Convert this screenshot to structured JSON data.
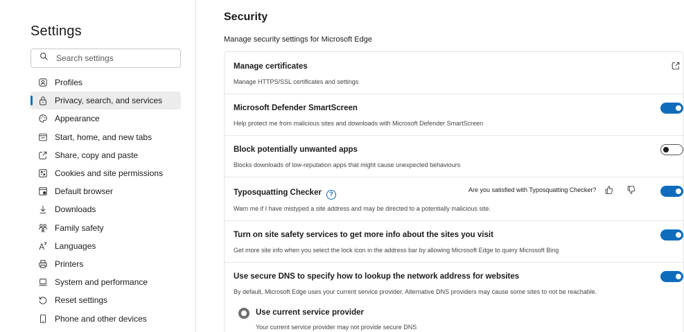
{
  "sidebar": {
    "title": "Settings",
    "search_placeholder": "Search settings",
    "items": [
      {
        "label": "Profiles",
        "icon": "profile-icon",
        "active": false
      },
      {
        "label": "Privacy, search, and services",
        "icon": "lock-icon",
        "active": true
      },
      {
        "label": "Appearance",
        "icon": "appearance-icon",
        "active": false
      },
      {
        "label": "Start, home, and new tabs",
        "icon": "home-tabs-icon",
        "active": false
      },
      {
        "label": "Share, copy and paste",
        "icon": "share-icon",
        "active": false
      },
      {
        "label": "Cookies and site permissions",
        "icon": "cookies-icon",
        "active": false
      },
      {
        "label": "Default browser",
        "icon": "browser-icon",
        "active": false
      },
      {
        "label": "Downloads",
        "icon": "download-icon",
        "active": false
      },
      {
        "label": "Family safety",
        "icon": "family-icon",
        "active": false
      },
      {
        "label": "Languages",
        "icon": "languages-icon",
        "active": false
      },
      {
        "label": "Printers",
        "icon": "printer-icon",
        "active": false
      },
      {
        "label": "System and performance",
        "icon": "system-icon",
        "active": false
      },
      {
        "label": "Reset settings",
        "icon": "reset-icon",
        "active": false
      },
      {
        "label": "Phone and other devices",
        "icon": "phone-icon",
        "active": false
      }
    ]
  },
  "main": {
    "title": "Security",
    "subtitle": "Manage security settings for Microsoft Edge",
    "rows": {
      "certificates": {
        "title": "Manage certificates",
        "desc": "Manage HTTPS/SSL certificates and settings"
      },
      "smartscreen": {
        "title": "Microsoft Defender SmartScreen",
        "desc": "Help protect me from malicious sites and downloads with Microsoft Defender SmartScreen",
        "enabled": true
      },
      "pua": {
        "title": "Block potentially unwanted apps",
        "desc": "Blocks downloads of low-reputation apps that might cause unexpected behaviours",
        "enabled": false
      },
      "typosquatting": {
        "title": "Typosquatting Checker",
        "help": "?",
        "feedback": "Are you satisfied with Typosquatting Checker?",
        "desc": "Warn me if I have mistyped a site address and may be directed to a potentially malicious site.",
        "enabled": true
      },
      "site_safety": {
        "title": "Turn on site safety services to get more info about the sites you visit",
        "desc": "Get more site info when you select the lock icon in the address bar by allowing Microsoft Edge to query Microsoft Bing",
        "enabled": true
      },
      "secure_dns": {
        "title": "Use secure DNS to specify how to lookup the network address for websites",
        "desc": "By default, Microsoft Edge uses your current service provider. Alternative DNS providers may cause some sites to not be reachable.",
        "enabled": true,
        "option_label": "Use current service provider",
        "option_desc": "Your current service provider may not provide secure DNS"
      }
    }
  },
  "colors": {
    "accent": "#0f6cbd",
    "active_nav_bg": "#ececec"
  }
}
